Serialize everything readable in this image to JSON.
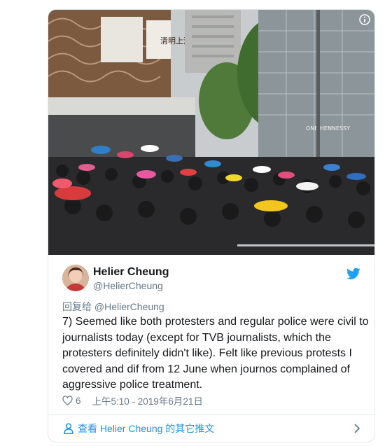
{
  "colors": {
    "twitter_blue": "#1da1f2",
    "link_blue": "#1b95e0",
    "muted_gray": "#657786",
    "border": "#e1e8ed"
  },
  "photo": {
    "alt_content": "crowd-of-protesters-with-umbrellas",
    "info_icon": "info-icon",
    "sign_text": [
      "清明上河圖",
      "ONE HENNESSY"
    ]
  },
  "author": {
    "name": "Helier Cheung",
    "handle": "@HelierCheung",
    "avatar_icon": "avatar",
    "brand_icon": "twitter-bird-icon"
  },
  "tweet": {
    "reply_prefix": "回复给",
    "reply_handle": "@HelierCheung",
    "text": "7) Seemed like both protesters and regular police were civil to journalists today (except for TVB journalists, which the protesters definitely didn't like). Felt like previous protests I covered and dif from 12 June when journos complained of aggressive police treatment.",
    "like_count": "6",
    "timestamp": "上午5:10 - 2019年6月21日"
  },
  "footer": {
    "more_label": "查看 Helier Cheung 的其它推文"
  }
}
